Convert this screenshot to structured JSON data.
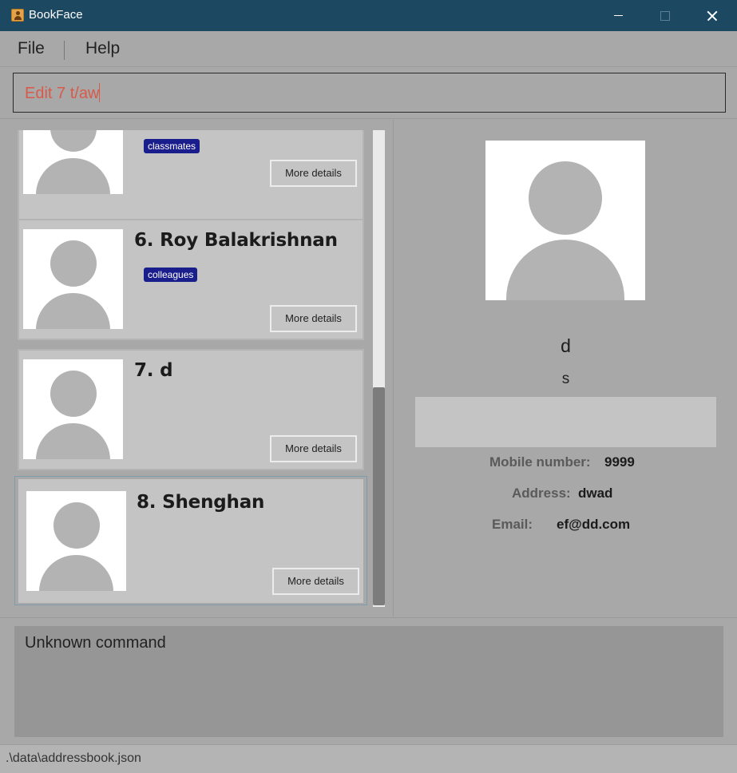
{
  "window": {
    "title": "BookFace"
  },
  "menu": {
    "file": "File",
    "help": "Help"
  },
  "command": {
    "value": "Edit 7 t/aw"
  },
  "cards": [
    {
      "name": "",
      "tag": "classmates",
      "more": "More details"
    },
    {
      "name": "6. Roy Balakrishnan",
      "tag": "colleagues",
      "more": "More details"
    },
    {
      "name": "7. d",
      "more": "More details"
    },
    {
      "name": "8. Shenghan",
      "more": "More details",
      "selected": true
    }
  ],
  "detail": {
    "name": "d",
    "subtitle": "s",
    "mobile_label": "Mobile number:",
    "mobile_value": "9999",
    "address_label": "Address:",
    "address_value": "dwad",
    "email_label": "Email:",
    "email_value": "ef@dd.com"
  },
  "result": {
    "text": "Unknown command"
  },
  "status": {
    "path": ".\\data\\addressbook.json"
  },
  "colors": {
    "titlebar": "#1c4862",
    "tag": "#1a1d8c",
    "command_text": "#d85a4a",
    "background": "#a8a8a8"
  }
}
